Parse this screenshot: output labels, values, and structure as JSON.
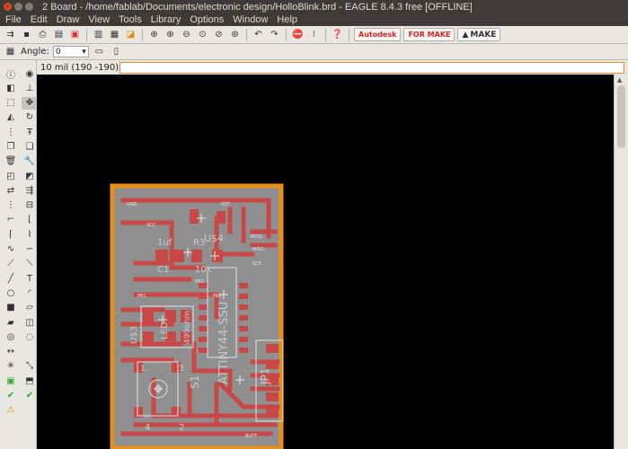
{
  "window": {
    "title": "2 Board - /home/fablab/Documents/electronic design/HolloBlink.brd - EAGLE 8.4.3 free [OFFLINE]"
  },
  "menu": [
    "File",
    "Edit",
    "Draw",
    "View",
    "Tools",
    "Library",
    "Options",
    "Window",
    "Help"
  ],
  "toolbar": {
    "brand_autodesk": "Autodesk",
    "brand_fusion": "FOR MAKE",
    "make_label": "MAKE"
  },
  "params": {
    "angle_label": "Angle:",
    "angle_value": "0"
  },
  "coordinates": {
    "readout": "10 mil (190 -190)",
    "command": ""
  },
  "board": {
    "labels": {
      "cap_value": "1uf",
      "cap_name": "C1",
      "res_name": "R3",
      "res_value": "10k",
      "ic_name": "U$4",
      "ic_part": "ATTINY44-SSU",
      "led_name": "U$3",
      "led_label": "LED",
      "res2_value": "499ohm",
      "switch_name": "S1",
      "switch_pin1": "1",
      "switch_pin2": "2",
      "switch_pin3": "3",
      "switch_pin4": "4",
      "header_name": "JP1"
    },
    "net_labels": [
      "GND",
      "VCC",
      "RST",
      "MOSI",
      "MISO",
      "SCK",
      "PB1",
      "PB2",
      "PA0",
      "BUTT"
    ]
  },
  "colors": {
    "board_outline": "#e8901a",
    "copper": "#c84848",
    "board_fill": "#8f8f8f",
    "canvas": "#000000"
  }
}
